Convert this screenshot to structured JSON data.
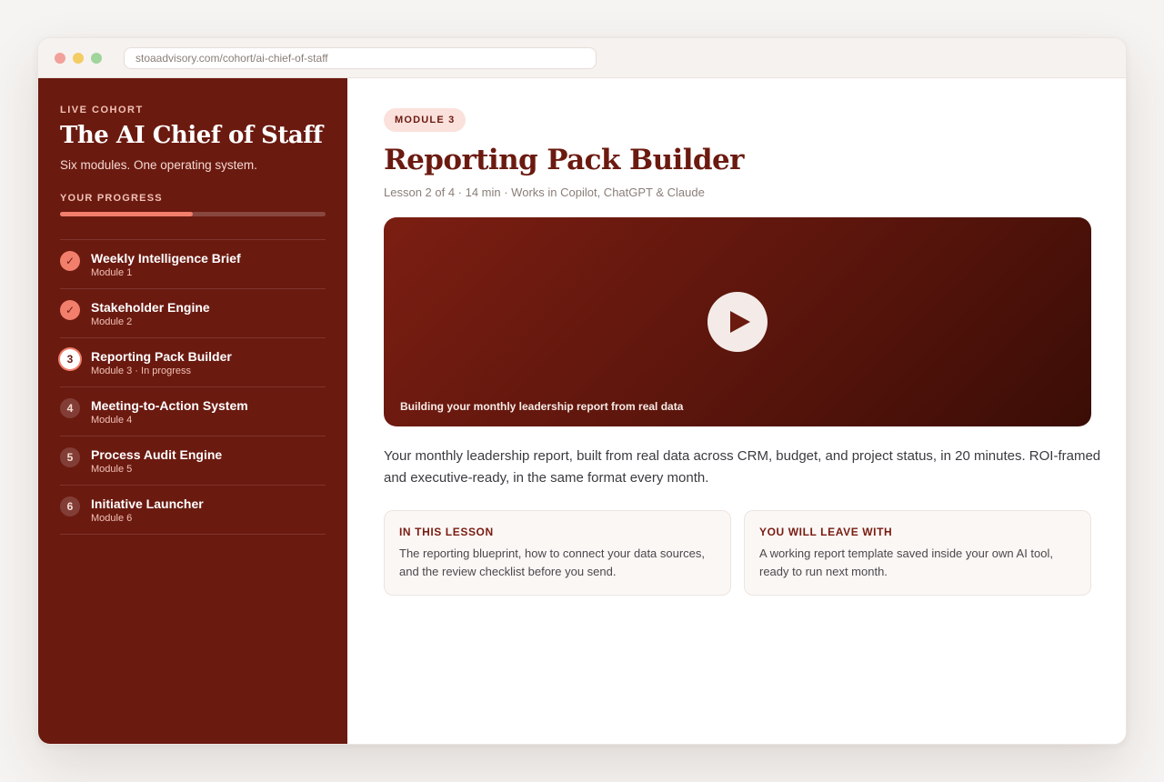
{
  "browser": {
    "url": "stoaadvisory.com/cohort/ai-chief-of-staff"
  },
  "sidebar": {
    "eyebrow": "LIVE COHORT",
    "title": "The AI Chief of Staff",
    "subtitle": "Six modules. One operating system.",
    "progress_label": "YOUR PROGRESS",
    "progress_fraction": 0.5,
    "modules": [
      {
        "icon": "✓",
        "status": "done",
        "name": "Weekly Intelligence Brief",
        "meta": "Module 1"
      },
      {
        "icon": "✓",
        "status": "done",
        "name": "Stakeholder Engine",
        "meta": "Module 2"
      },
      {
        "icon": "3",
        "status": "current",
        "name": "Reporting Pack Builder",
        "meta": "Module 3 · In progress"
      },
      {
        "icon": "4",
        "status": "todo",
        "name": "Meeting-to-Action System",
        "meta": "Module 4"
      },
      {
        "icon": "5",
        "status": "todo",
        "name": "Process Audit Engine",
        "meta": "Module 5"
      },
      {
        "icon": "6",
        "status": "todo",
        "name": "Initiative Launcher",
        "meta": "Module 6"
      }
    ]
  },
  "main": {
    "badge": "MODULE 3",
    "title": "Reporting Pack Builder",
    "meta": "Lesson 2 of 4 · 14 min · Works in Copilot, ChatGPT & Claude",
    "video_caption": "Building your monthly leadership report from real data",
    "description": "Your monthly leadership report, built from real data across CRM, budget, and project status, in 20 minutes. ROI-framed and executive-ready, in the same format every month.",
    "cards": [
      {
        "heading": "IN THIS LESSON",
        "body": "The reporting blueprint, how to connect your data sources, and the review checklist before you send."
      },
      {
        "heading": "YOU WILL LEAVE WITH",
        "body": "A working report template saved inside your own AI tool, ready to run next month."
      }
    ]
  },
  "colors": {
    "brand": "#6b1a10",
    "accent": "#f17f6c",
    "badge_bg": "#fbe1dc"
  }
}
